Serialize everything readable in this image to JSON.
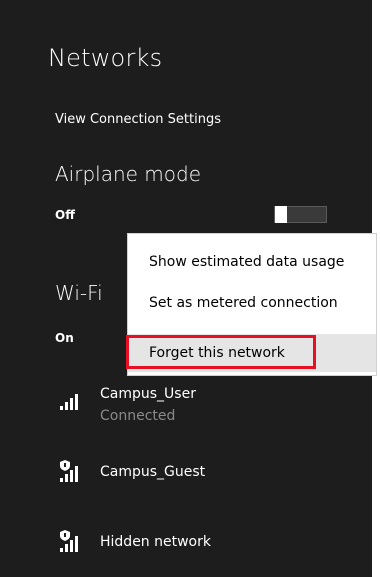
{
  "panel": {
    "title": "Networks",
    "view_settings": "View Connection Settings",
    "airplane": {
      "label": "Airplane mode",
      "status": "Off"
    },
    "wifi": {
      "label": "Wi-Fi",
      "status": "On"
    }
  },
  "networks": [
    {
      "name": "Campus_User",
      "status": "Connected",
      "icon": "wifi-signal-icon"
    },
    {
      "name": "Campus_Guest",
      "status": "",
      "icon": "wifi-secured-signal-icon"
    },
    {
      "name": "Hidden network",
      "status": "",
      "icon": "wifi-secured-signal-icon"
    }
  ],
  "context_menu": {
    "items": [
      {
        "label": "Show estimated data usage"
      },
      {
        "label": "Set as metered connection"
      },
      {
        "label": "Forget this network"
      }
    ]
  },
  "colors": {
    "panel_bg": "#1d1d1d",
    "highlight_border": "#e81123",
    "menu_hover": "#e5e5e5"
  }
}
